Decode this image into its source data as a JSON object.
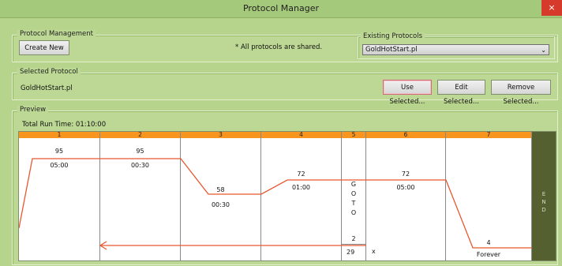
{
  "window": {
    "title": "Protocol Manager",
    "close_glyph": "×"
  },
  "management": {
    "legend": "Protocol Management",
    "create_new": "Create New",
    "shared_note": "* All protocols are shared.",
    "existing_legend": "Existing Protocols",
    "existing_value": "GoldHotStart.pl",
    "chevron": "⌄"
  },
  "selected": {
    "legend": "Selected Protocol",
    "name": "GoldHotStart.pl",
    "use_selected": "Use Selected...",
    "edit_selected": "Edit Selected...",
    "remove_selected": "Remove Selected..."
  },
  "preview": {
    "legend": "Preview",
    "total_run_time": "Total Run Time:  01:10:00",
    "steps": [
      {
        "num": "1",
        "temp": "95",
        "time": "05:00"
      },
      {
        "num": "2",
        "temp": "95",
        "time": "00:30"
      },
      {
        "num": "3",
        "temp": "58",
        "time": "00:30"
      },
      {
        "num": "4",
        "temp": "72",
        "time": "01:00"
      },
      {
        "num": "5",
        "goto_letters": [
          "G",
          "O",
          "T",
          "O"
        ],
        "goto_target": "2",
        "repeat": "29",
        "repeat_mark": "x"
      },
      {
        "num": "6",
        "temp": "72",
        "time": "05:00"
      },
      {
        "num": "7",
        "temp": "4",
        "time": "Forever"
      }
    ],
    "end_letters": [
      "E",
      "N",
      "D"
    ]
  },
  "colors": {
    "header": "#f7951e",
    "line": "#e8572f",
    "end": "#54602f"
  }
}
